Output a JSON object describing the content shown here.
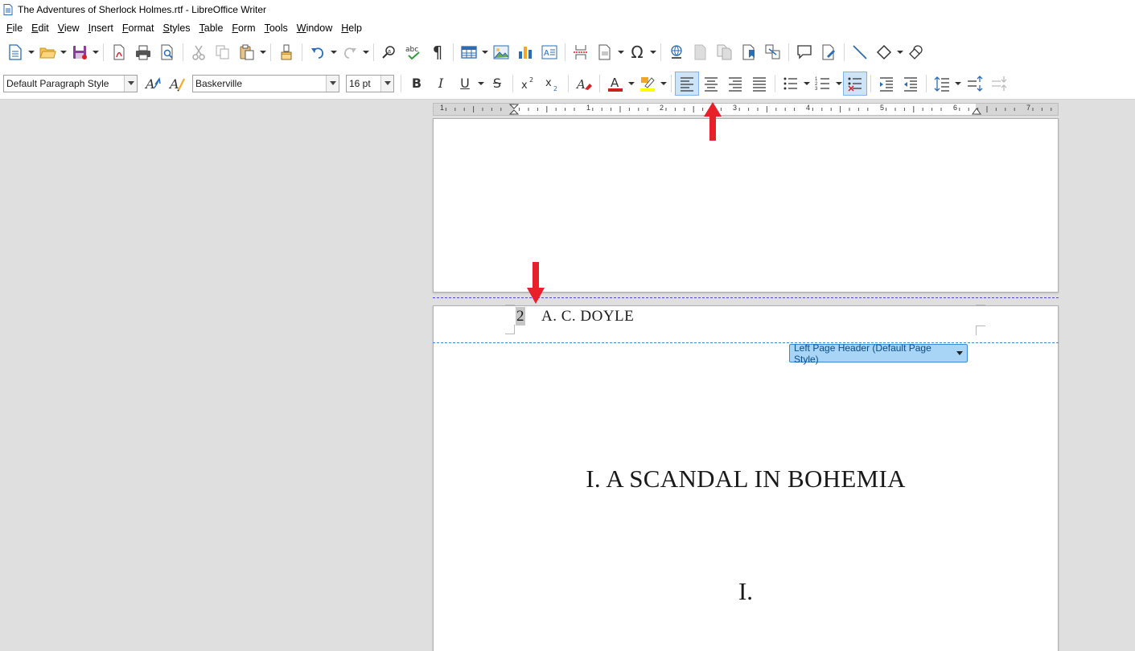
{
  "window": {
    "title": "The Adventures of Sherlock Holmes.rtf - LibreOffice Writer"
  },
  "menu": [
    "File",
    "Edit",
    "View",
    "Insert",
    "Format",
    "Styles",
    "Table",
    "Form",
    "Tools",
    "Window",
    "Help"
  ],
  "formatting": {
    "paragraph_style": "Default Paragraph Style",
    "font_name": "Baskerville",
    "font_size": "16 pt"
  },
  "ruler": {
    "numbers": [
      "1",
      "1",
      "2",
      "3",
      "4",
      "5",
      "6",
      "7"
    ]
  },
  "document": {
    "header_page_number": "2",
    "header_author": "A. C. DOYLE",
    "header_tag": "Left Page Header (Default Page Style)",
    "chapter_title": "I. A SCANDAL IN BOHEMIA",
    "section_number": "I."
  },
  "colors": {
    "accent_highlight": "#cde3f7",
    "arrow": "#e8202a",
    "header_tag_bg": "#a8d4f5",
    "font_color_bar": "#c9211e",
    "highlight_bar": "#ffff00"
  }
}
